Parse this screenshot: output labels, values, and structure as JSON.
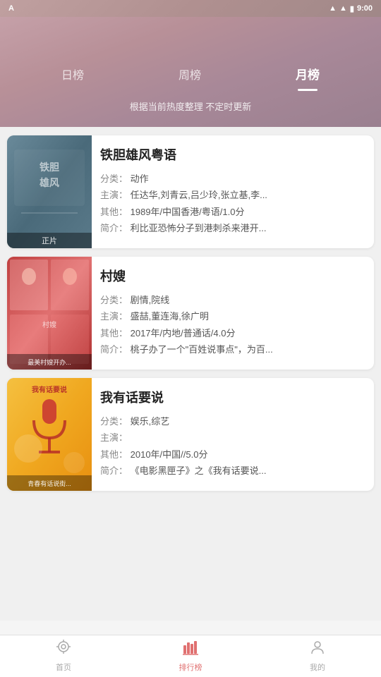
{
  "statusBar": {
    "time": "9:00",
    "appIcon": "A"
  },
  "tabs": [
    {
      "id": "daily",
      "label": "日榜",
      "active": false
    },
    {
      "id": "weekly",
      "label": "周榜",
      "active": false
    },
    {
      "id": "monthly",
      "label": "月榜",
      "active": true
    }
  ],
  "subtitle": "根据当前热度整理 不定时更新",
  "movies": [
    {
      "id": 1,
      "title": "铁胆雄风粤语",
      "category": "动作",
      "cast": "任达华,刘青云,吕少玲,张立基,李...",
      "other": "1989年/中国香港/粤语/1.0分",
      "summary": "利比亚恐怖分子到港刺杀来港开...",
      "posterLabel": "正片",
      "posterType": "1"
    },
    {
      "id": 2,
      "title": "村嫂",
      "category": "剧情,院线",
      "cast": "盛喆,董连海,徐广明",
      "other": "2017年/内地/普通话/4.0分",
      "summary": "桃子办了一个\"百姓说事点\"，为百...",
      "posterLabel": "最美村嫂开办...",
      "posterType": "2"
    },
    {
      "id": 3,
      "title": "我有话要说",
      "category": "娱乐,综艺",
      "cast": "",
      "other": "2010年/中国//5.0分",
      "summary": "《电影黑匣子》之《我有话要说...",
      "posterLabel": "青春有话说街...",
      "posterType": "3"
    }
  ],
  "bottomNav": [
    {
      "id": "home",
      "label": "首页",
      "icon": "home",
      "active": false
    },
    {
      "id": "ranking",
      "label": "排行榜",
      "icon": "ranking",
      "active": true
    },
    {
      "id": "mine",
      "label": "我的",
      "icon": "user",
      "active": false
    }
  ],
  "labels": {
    "category": "分类：",
    "cast": "主演：",
    "other": "其他：",
    "summary": "简介："
  }
}
